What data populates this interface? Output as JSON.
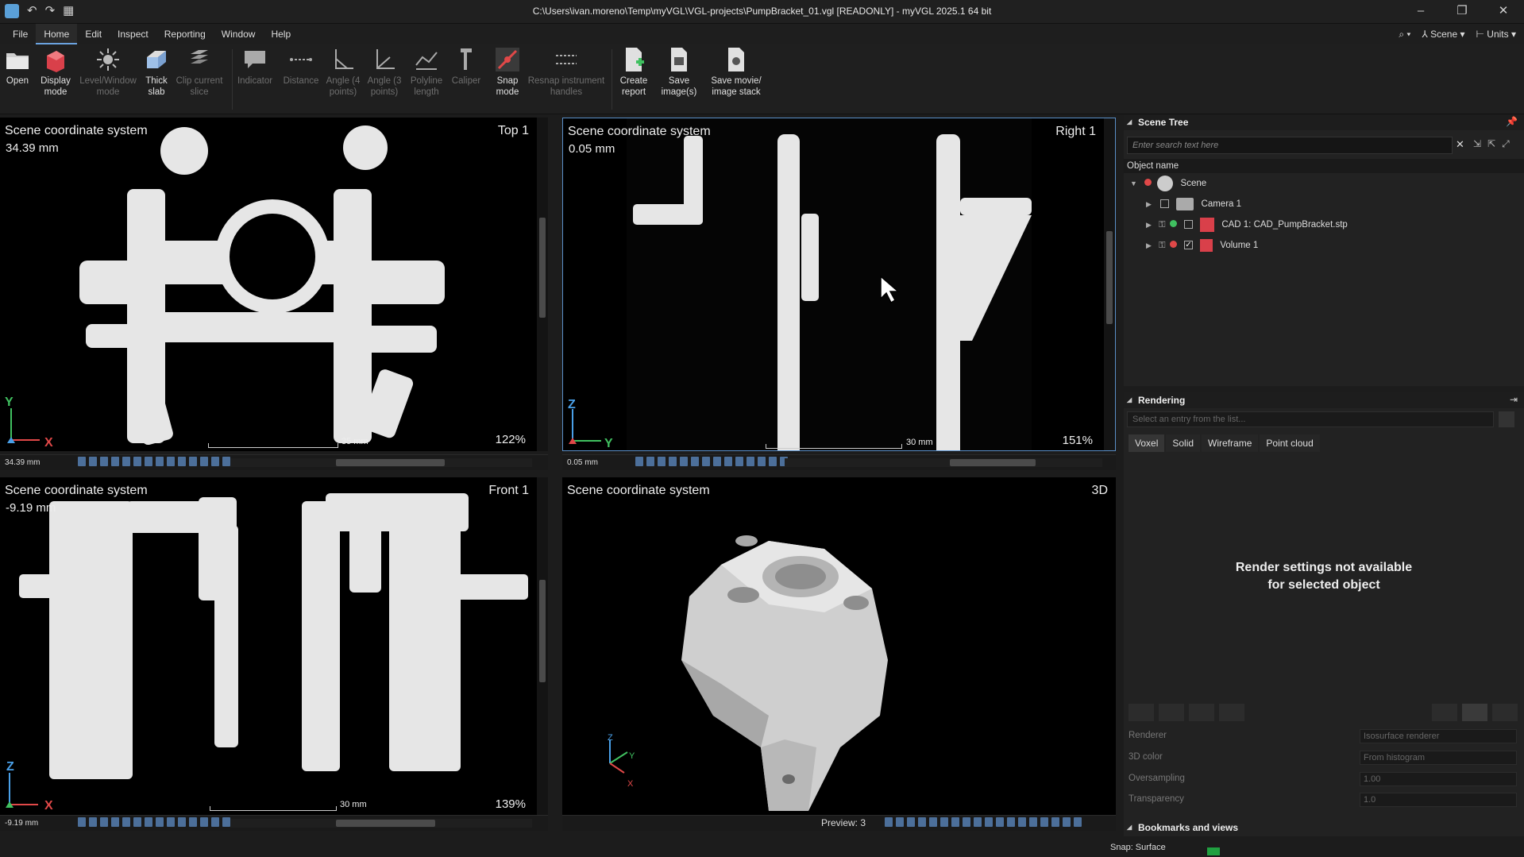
{
  "window": {
    "title": "C:\\Users\\ivan.moreno\\Temp\\myVGL\\VGL-projects\\PumpBracket_01.vgl [READONLY] - myVGL 2025.1 64 bit",
    "minimize": "–",
    "restore": "❐",
    "close": "✕"
  },
  "quick_access": {
    "undo": "↶",
    "redo": "↷",
    "layout": "▦"
  },
  "menu": [
    "File",
    "Home",
    "Edit",
    "Inspect",
    "Reporting",
    "Window",
    "Help"
  ],
  "menu_right": {
    "scene": "Scene",
    "units": "Units"
  },
  "ribbon": {
    "open": "Open",
    "display_mode": "Display\nmode",
    "level_window": "Level/Window\nmode",
    "thick_slab": "Thick\nslab",
    "clip_slice": "Clip current\nslice",
    "indicator": "Indicator",
    "distance": "Distance",
    "angle4": "Angle (4\npoints)",
    "angle3": "Angle (3\npoints)",
    "polyline": "Polyline\nlength",
    "caliper": "Caliper",
    "snap_mode": "Snap\nmode",
    "resnap": "Resnap instrument\nhandles",
    "create_report": "Create\nreport",
    "save_images": "Save\nimage(s)",
    "save_movie": "Save movie/\nimage stack"
  },
  "viewports": {
    "top": {
      "label": "Scene coordinate system",
      "name": "Top 1",
      "position": "34.39 mm",
      "zoom": "122%",
      "scale": "35 mm",
      "axis_v": "Y",
      "axis_h": "X",
      "field_value": "34.39 mm",
      "scroll": {
        "v_start": 0.3,
        "v_size": 0.3,
        "h_start": 0.35,
        "h_size": 0.36
      }
    },
    "right": {
      "label": "Scene coordinate system",
      "name": "Right 1",
      "position": "0.05 mm",
      "zoom": "151%",
      "scale": "30 mm",
      "axis_v": "Z",
      "axis_h": "Y",
      "field_value": "0.05 mm",
      "scroll": {
        "v_start": 0.34,
        "v_size": 0.28,
        "h_start": 0.52,
        "h_size": 0.27
      }
    },
    "front": {
      "label": "Scene coordinate system",
      "name": "Front 1",
      "position": "-9.19 mm",
      "zoom": "139%",
      "scale": "30 mm",
      "axis_v": "Z",
      "axis_h": "X",
      "field_value": "-9.19 mm",
      "scroll": {
        "v_start": 0.3,
        "v_size": 0.3,
        "h_start": 0.35,
        "h_size": 0.33
      }
    },
    "three_d": {
      "label": "Scene coordinate system",
      "name": "3D",
      "preview": "Preview:  3",
      "axis_z": "Z",
      "axis_y": "Y",
      "axis_x": "X"
    }
  },
  "scene_tree": {
    "title": "Scene Tree",
    "search_placeholder": "Enter search text here",
    "column": "Object name",
    "items": [
      {
        "label": "Scene"
      },
      {
        "label": "Camera 1"
      },
      {
        "label": "CAD 1: CAD_PumpBracket.stp"
      },
      {
        "label": "Volume 1"
      }
    ]
  },
  "rendering": {
    "title": "Rendering",
    "select_placeholder": "Select an entry from the list...",
    "tabs": [
      "Voxel",
      "Solid",
      "Wireframe",
      "Point cloud"
    ],
    "message_line1": "Render settings not available",
    "message_line2": "for selected object",
    "properties": [
      {
        "label": "Renderer",
        "value": "Isosurface renderer"
      },
      {
        "label": "3D color",
        "value": "From histogram"
      },
      {
        "label": "Oversampling",
        "value": "1.00"
      },
      {
        "label": "Transparency",
        "value": "1.0"
      }
    ]
  },
  "bookmarks": {
    "title": "Bookmarks and views"
  },
  "status": {
    "snap": "Snap: Surface"
  },
  "colors": {
    "background": "#000000",
    "panel": "#222222",
    "accent": "#6ba3e0",
    "axis_x": "#e04848",
    "axis_y": "#40c060",
    "axis_z": "#4aa0e8"
  }
}
